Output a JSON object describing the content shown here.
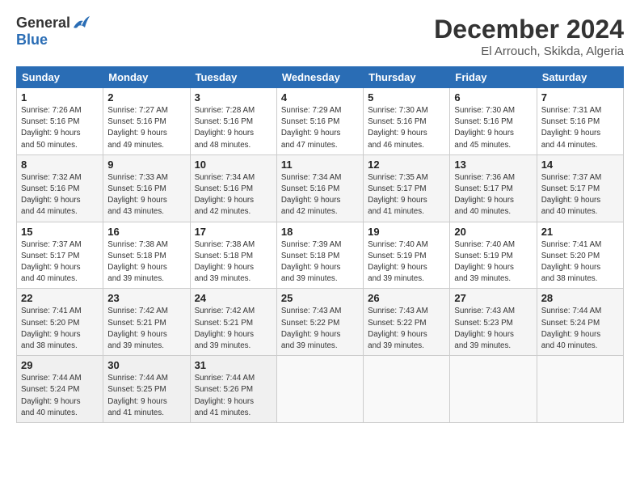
{
  "header": {
    "logo_general": "General",
    "logo_blue": "Blue",
    "month_title": "December 2024",
    "location": "El Arrouch, Skikda, Algeria"
  },
  "days_of_week": [
    "Sunday",
    "Monday",
    "Tuesday",
    "Wednesday",
    "Thursday",
    "Friday",
    "Saturday"
  ],
  "weeks": [
    [
      {
        "day": "1",
        "info": "Sunrise: 7:26 AM\nSunset: 5:16 PM\nDaylight: 9 hours\nand 50 minutes."
      },
      {
        "day": "2",
        "info": "Sunrise: 7:27 AM\nSunset: 5:16 PM\nDaylight: 9 hours\nand 49 minutes."
      },
      {
        "day": "3",
        "info": "Sunrise: 7:28 AM\nSunset: 5:16 PM\nDaylight: 9 hours\nand 48 minutes."
      },
      {
        "day": "4",
        "info": "Sunrise: 7:29 AM\nSunset: 5:16 PM\nDaylight: 9 hours\nand 47 minutes."
      },
      {
        "day": "5",
        "info": "Sunrise: 7:30 AM\nSunset: 5:16 PM\nDaylight: 9 hours\nand 46 minutes."
      },
      {
        "day": "6",
        "info": "Sunrise: 7:30 AM\nSunset: 5:16 PM\nDaylight: 9 hours\nand 45 minutes."
      },
      {
        "day": "7",
        "info": "Sunrise: 7:31 AM\nSunset: 5:16 PM\nDaylight: 9 hours\nand 44 minutes."
      }
    ],
    [
      {
        "day": "8",
        "info": "Sunrise: 7:32 AM\nSunset: 5:16 PM\nDaylight: 9 hours\nand 44 minutes."
      },
      {
        "day": "9",
        "info": "Sunrise: 7:33 AM\nSunset: 5:16 PM\nDaylight: 9 hours\nand 43 minutes."
      },
      {
        "day": "10",
        "info": "Sunrise: 7:34 AM\nSunset: 5:16 PM\nDaylight: 9 hours\nand 42 minutes."
      },
      {
        "day": "11",
        "info": "Sunrise: 7:34 AM\nSunset: 5:16 PM\nDaylight: 9 hours\nand 42 minutes."
      },
      {
        "day": "12",
        "info": "Sunrise: 7:35 AM\nSunset: 5:17 PM\nDaylight: 9 hours\nand 41 minutes."
      },
      {
        "day": "13",
        "info": "Sunrise: 7:36 AM\nSunset: 5:17 PM\nDaylight: 9 hours\nand 40 minutes."
      },
      {
        "day": "14",
        "info": "Sunrise: 7:37 AM\nSunset: 5:17 PM\nDaylight: 9 hours\nand 40 minutes."
      }
    ],
    [
      {
        "day": "15",
        "info": "Sunrise: 7:37 AM\nSunset: 5:17 PM\nDaylight: 9 hours\nand 40 minutes."
      },
      {
        "day": "16",
        "info": "Sunrise: 7:38 AM\nSunset: 5:18 PM\nDaylight: 9 hours\nand 39 minutes."
      },
      {
        "day": "17",
        "info": "Sunrise: 7:38 AM\nSunset: 5:18 PM\nDaylight: 9 hours\nand 39 minutes."
      },
      {
        "day": "18",
        "info": "Sunrise: 7:39 AM\nSunset: 5:18 PM\nDaylight: 9 hours\nand 39 minutes."
      },
      {
        "day": "19",
        "info": "Sunrise: 7:40 AM\nSunset: 5:19 PM\nDaylight: 9 hours\nand 39 minutes."
      },
      {
        "day": "20",
        "info": "Sunrise: 7:40 AM\nSunset: 5:19 PM\nDaylight: 9 hours\nand 39 minutes."
      },
      {
        "day": "21",
        "info": "Sunrise: 7:41 AM\nSunset: 5:20 PM\nDaylight: 9 hours\nand 38 minutes."
      }
    ],
    [
      {
        "day": "22",
        "info": "Sunrise: 7:41 AM\nSunset: 5:20 PM\nDaylight: 9 hours\nand 38 minutes."
      },
      {
        "day": "23",
        "info": "Sunrise: 7:42 AM\nSunset: 5:21 PM\nDaylight: 9 hours\nand 39 minutes."
      },
      {
        "day": "24",
        "info": "Sunrise: 7:42 AM\nSunset: 5:21 PM\nDaylight: 9 hours\nand 39 minutes."
      },
      {
        "day": "25",
        "info": "Sunrise: 7:43 AM\nSunset: 5:22 PM\nDaylight: 9 hours\nand 39 minutes."
      },
      {
        "day": "26",
        "info": "Sunrise: 7:43 AM\nSunset: 5:22 PM\nDaylight: 9 hours\nand 39 minutes."
      },
      {
        "day": "27",
        "info": "Sunrise: 7:43 AM\nSunset: 5:23 PM\nDaylight: 9 hours\nand 39 minutes."
      },
      {
        "day": "28",
        "info": "Sunrise: 7:44 AM\nSunset: 5:24 PM\nDaylight: 9 hours\nand 40 minutes."
      }
    ],
    [
      {
        "day": "29",
        "info": "Sunrise: 7:44 AM\nSunset: 5:24 PM\nDaylight: 9 hours\nand 40 minutes."
      },
      {
        "day": "30",
        "info": "Sunrise: 7:44 AM\nSunset: 5:25 PM\nDaylight: 9 hours\nand 41 minutes."
      },
      {
        "day": "31",
        "info": "Sunrise: 7:44 AM\nSunset: 5:26 PM\nDaylight: 9 hours\nand 41 minutes."
      },
      {
        "day": "",
        "info": ""
      },
      {
        "day": "",
        "info": ""
      },
      {
        "day": "",
        "info": ""
      },
      {
        "day": "",
        "info": ""
      }
    ]
  ]
}
